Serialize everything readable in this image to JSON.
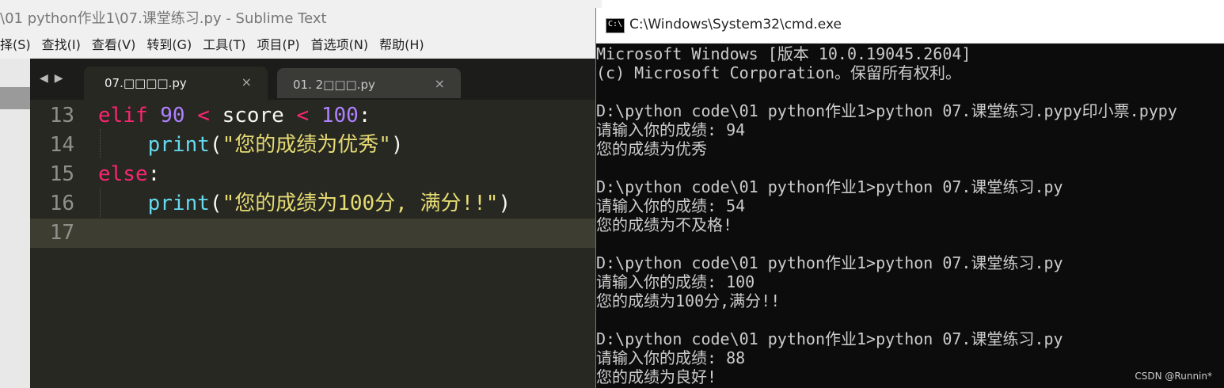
{
  "sublime": {
    "title": "\\01 python作业1\\07.课堂练习.py - Sublime Text",
    "menu": [
      "择(S)",
      "查找(I)",
      "查看(V)",
      "转到(G)",
      "工具(T)",
      "项目(P)",
      "首选项(N)",
      "帮助(H)"
    ],
    "tab_nav": "◀▶",
    "tabs": [
      {
        "label": "07.□□□□.py",
        "close": "×"
      },
      {
        "label": "01. 2□□□.py",
        "close": "×"
      }
    ],
    "lines": [
      {
        "num": "13"
      },
      {
        "num": "14"
      },
      {
        "num": "15"
      },
      {
        "num": "16"
      },
      {
        "num": "17"
      }
    ],
    "code": {
      "l13": {
        "kw1": "elif",
        "n1": "90",
        "op1": "<",
        "var": "score",
        "op2": "<",
        "n2": "100",
        "colon": ":"
      },
      "l14": {
        "fn": "print",
        "open": "(",
        "str": "\"您的成绩为优秀\"",
        "close": ")"
      },
      "l15": {
        "kw": "else",
        "colon": ":"
      },
      "l16": {
        "fn": "print",
        "open": "(",
        "str": "\"您的成绩为100分, 满分!!\"",
        "close": ")"
      }
    }
  },
  "cmd": {
    "title": "C:\\Windows\\System32\\cmd.exe",
    "icon_text": "C:\\",
    "lines": [
      "Microsoft Windows [版本 10.0.19045.2604]",
      "(c) Microsoft Corporation。保留所有权利。",
      "",
      "D:\\python code\\01 python作业1>python 07.课堂练习.pypy印小票.pypy",
      "请输入你的成绩: 94",
      "您的成绩为优秀",
      "",
      "D:\\python code\\01 python作业1>python 07.课堂练习.py",
      "请输入你的成绩: 54",
      "您的成绩为不及格!",
      "",
      "D:\\python code\\01 python作业1>python 07.课堂练习.py",
      "请输入你的成绩: 100",
      "您的成绩为100分,满分!!",
      "",
      "D:\\python code\\01 python作业1>python 07.课堂练习.py",
      "请输入你的成绩: 88",
      "您的成绩为良好!"
    ],
    "watermark": "CSDN @Runnin*"
  }
}
